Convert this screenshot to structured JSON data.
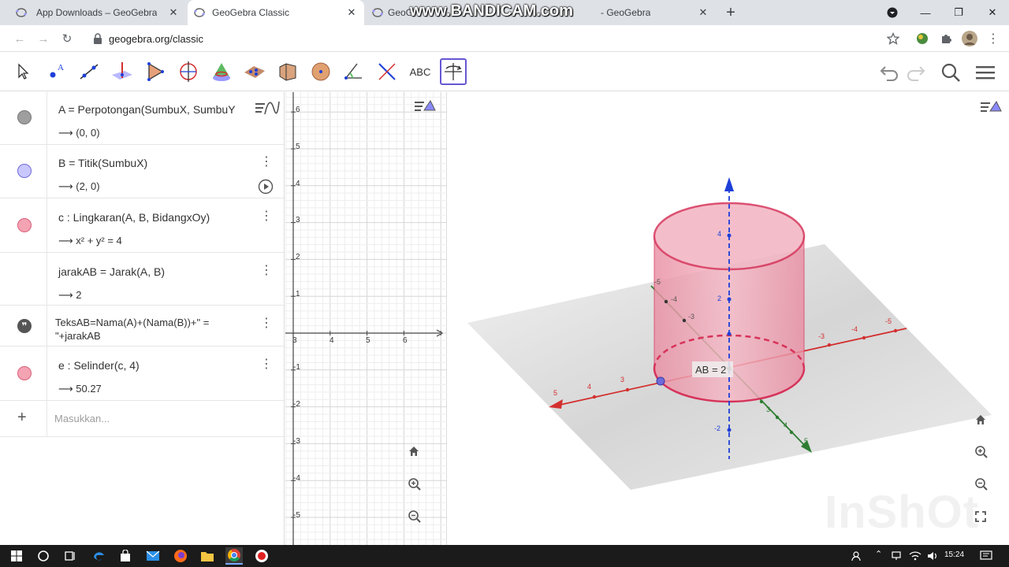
{
  "browser": {
    "tabs": [
      {
        "label": "App Downloads – GeoGebra",
        "active": false
      },
      {
        "label": "GeoGebra Classic",
        "active": true
      },
      {
        "label": "GeoG",
        "active": false
      },
      {
        "label": "- GeoGebra",
        "active": false
      }
    ],
    "watermark": "www.BANDICAM.com",
    "url": "geogebra.org/classic"
  },
  "toolbar": {
    "text_tool_label": "ABC"
  },
  "algebra": {
    "rows": [
      {
        "definition": "A = Perpotongan(SumbuX, SumbuY",
        "value": "⟶ (0, 0)",
        "color": "#9e9e9e"
      },
      {
        "definition": "B = Titik(SumbuX)",
        "value": "⟶ (2, 0)",
        "color": "#c9c7ff"
      },
      {
        "definition": "c : Lingkaran(A, B, BidangxOy)",
        "value": "⟶ x² + y² = 4",
        "color": "#f4a3b3"
      },
      {
        "definition": "jarakAB = Jarak(A, B)",
        "value": "⟶ 2",
        "color": ""
      },
      {
        "definition": "TeksAB=Nama(A)+(Nama(B))+\" =",
        "value": "\"+jarakAB",
        "color": "#555555"
      },
      {
        "definition": "e : Selinder(c, 4)",
        "value": "⟶ 50.27",
        "color": "#f4a3b3"
      }
    ],
    "input_placeholder": "Masukkan..."
  },
  "graphics2d": {
    "y_ticks": [
      "6",
      "5",
      "4",
      "3",
      "2",
      "1",
      "-1",
      "-2",
      "-3",
      "-4",
      "-5"
    ],
    "x_ticks": [
      "3",
      "4",
      "5",
      "6"
    ]
  },
  "graphics3d": {
    "label_ab": "AB = 2",
    "x_axis_ticks": [
      "5",
      "4",
      "3",
      "-3",
      "-4",
      "-5"
    ],
    "y_axis_ticks": [
      "-5",
      "-4",
      "-3",
      "3",
      "4",
      "5"
    ],
    "z_axis_ticks": [
      "4",
      "2",
      "-2"
    ],
    "inshot_watermark": "InShOt"
  },
  "taskbar": {
    "time": "15:24"
  },
  "colors": {
    "cylinder": "#e05a7a",
    "x_axis": "#d32f2f",
    "y_axis": "#2e7d32",
    "z_axis": "#1e3fd8",
    "selection": "#6557d2"
  }
}
